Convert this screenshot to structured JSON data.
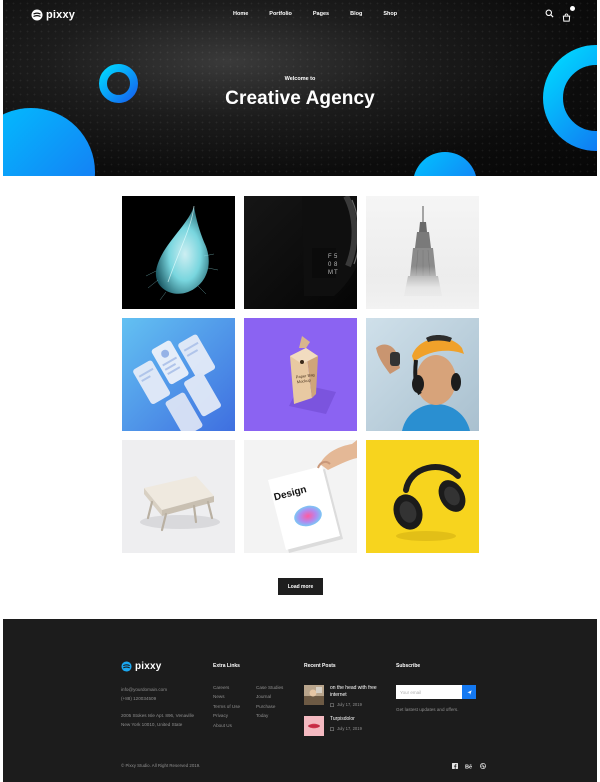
{
  "header": {
    "brand": "pixxy",
    "nav": [
      "Home",
      "Portfolio",
      "Pages",
      "Blog",
      "Shop"
    ],
    "icons": [
      "search-icon",
      "cart-icon"
    ]
  },
  "hero": {
    "subtitle": "Welcome to",
    "title": "Creative Agency",
    "accent_colors": [
      "#00c8ff",
      "#1479f2"
    ]
  },
  "portfolio": {
    "items": [
      "feather-splash",
      "dark-watch-closeup",
      "skyscraper",
      "app-screens-mockup",
      "paper-bag-mockup",
      "man-with-headphones",
      "white-table-model",
      "design-poster-in-hand",
      "headphones-on-yellow"
    ],
    "load_more_label": "Load more"
  },
  "footer": {
    "brand": "pixxy",
    "contact": {
      "email": "info@yourdomain.com",
      "phone": "(+88) 120034509",
      "address_line1": "2005 Stokes Isle Apt. 896, Venaville",
      "address_line2": "New York 10010, United State"
    },
    "extra_links_title": "Extra Links",
    "extra_links_col1": [
      "Careers",
      "News",
      "Terms of Use",
      "Privacy",
      "About Us"
    ],
    "extra_links_col2": [
      "Case Studies",
      "Journal",
      "Purchase",
      "Today"
    ],
    "recent_posts_title": "Recent Posts",
    "recent_posts": [
      {
        "title": "on the head with free internet",
        "date": "July 17, 2019"
      },
      {
        "title": "Turpisdolor",
        "date": "July 17, 2019"
      }
    ],
    "subscribe_title": "Subscribe",
    "subscribe_placeholder": "Your email",
    "subscribe_note": "Get lastest updates and offers.",
    "copyright": "© Pixxy Studio. All Right Reserved 2019.",
    "social_icons": [
      "facebook-icon",
      "behance-icon",
      "dribbble-icon"
    ]
  }
}
